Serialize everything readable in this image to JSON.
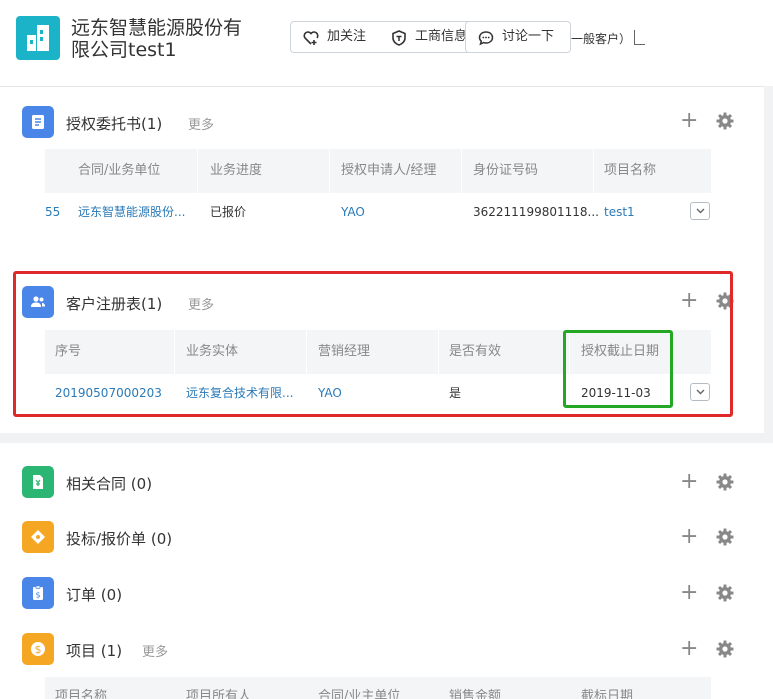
{
  "header": {
    "company_line1": "远东智慧能源股份有",
    "company_line2": "限公司test1",
    "follow_label": "加关注",
    "biz_info_label": "工商信息",
    "discuss_label": "讨论一下",
    "customer_type": "一般客户）"
  },
  "sections": {
    "auth": {
      "title": "授权委托书",
      "count": "(1)",
      "more": "更多",
      "columns": [
        "合同/业务单位",
        "业务进度",
        "授权申请人/经理",
        "身份证号码",
        "项目名称"
      ],
      "row": {
        "id_fragment": "55",
        "unit": "远东智慧能源股份...",
        "progress": "已报价",
        "applicant": "YAO",
        "idcard": "362211199801118...",
        "project": "test1"
      }
    },
    "register": {
      "title": "客户注册表",
      "count": "(1)",
      "more": "更多",
      "columns": [
        "序号",
        "业务实体",
        "营销经理",
        "是否有效",
        "授权截止日期"
      ],
      "row": {
        "serial": "20190507000203",
        "entity": "远东复合技术有限...",
        "manager": "YAO",
        "valid": "是",
        "deadline": "2019-11-03"
      }
    },
    "contracts": {
      "title": "相关合同",
      "count": "(0)"
    },
    "bids": {
      "title": "投标/报价单",
      "count": "(0)"
    },
    "orders": {
      "title": "订单",
      "count": "(0)"
    },
    "projects": {
      "title": "项目",
      "count": "(1)",
      "more": "更多",
      "columns": [
        "项目名称",
        "项目所有人",
        "合同/业主单位",
        "销售金额",
        "截标日期"
      ]
    }
  },
  "colors": {
    "accent": "#2a7ab8",
    "red_highlight": "#e02a2a",
    "green_highlight": "#23a824",
    "logo": "#1ab3c7"
  }
}
